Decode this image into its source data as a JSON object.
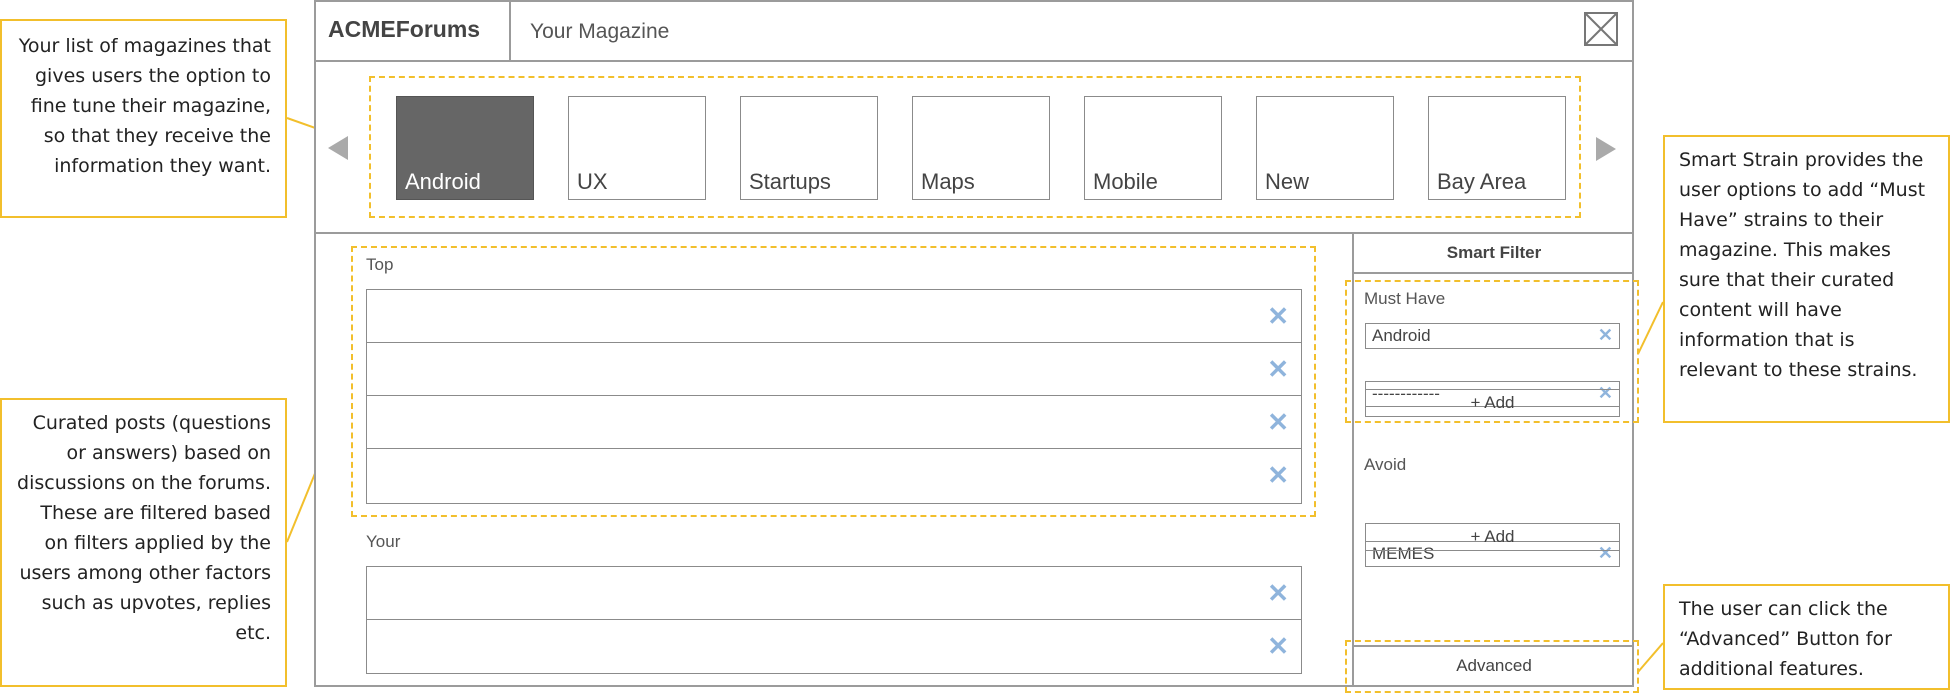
{
  "app": {
    "brand": "ACMEForums",
    "page_title": "Your Magazine"
  },
  "magazines": [
    {
      "label": "Android",
      "active": true
    },
    {
      "label": "UX",
      "active": false
    },
    {
      "label": "Startups",
      "active": false
    },
    {
      "label": "Maps",
      "active": false
    },
    {
      "label": "Mobile",
      "active": false
    },
    {
      "label": "New",
      "active": false
    },
    {
      "label": "Bay Area",
      "active": false
    }
  ],
  "feed": {
    "top_label": "Top",
    "your_label": "Your"
  },
  "smart_filter": {
    "title": "Smart Filter",
    "must_have_label": "Must Have",
    "must_have_items": [
      "Android",
      "------------"
    ],
    "must_have_add": "+ Add",
    "avoid_label": "Avoid",
    "avoid_items": [
      "MEMES"
    ],
    "avoid_add": "+ Add",
    "advanced": "Advanced"
  },
  "annotations": {
    "magazines": "Your list of magazines that gives users the option to fine tune their magazine, so that they receive the information they want.",
    "posts": "Curated posts (questions or answers) based on discussions on the forums. These are filtered based on filters applied by the users among other factors such as upvotes, replies etc.",
    "smart_strain": "Smart Strain provides the user options to add “Must Have” strains to their magazine. This makes sure that their curated content will have information that is relevant to these strains.",
    "advanced": "The user can click the “Advanced” Button for additional features."
  },
  "colors": {
    "annotation_accent": "#f2bf2c",
    "active_tile": "#666666",
    "remove_icon": "#8fb4dc",
    "frame": "#9b9b9b"
  }
}
